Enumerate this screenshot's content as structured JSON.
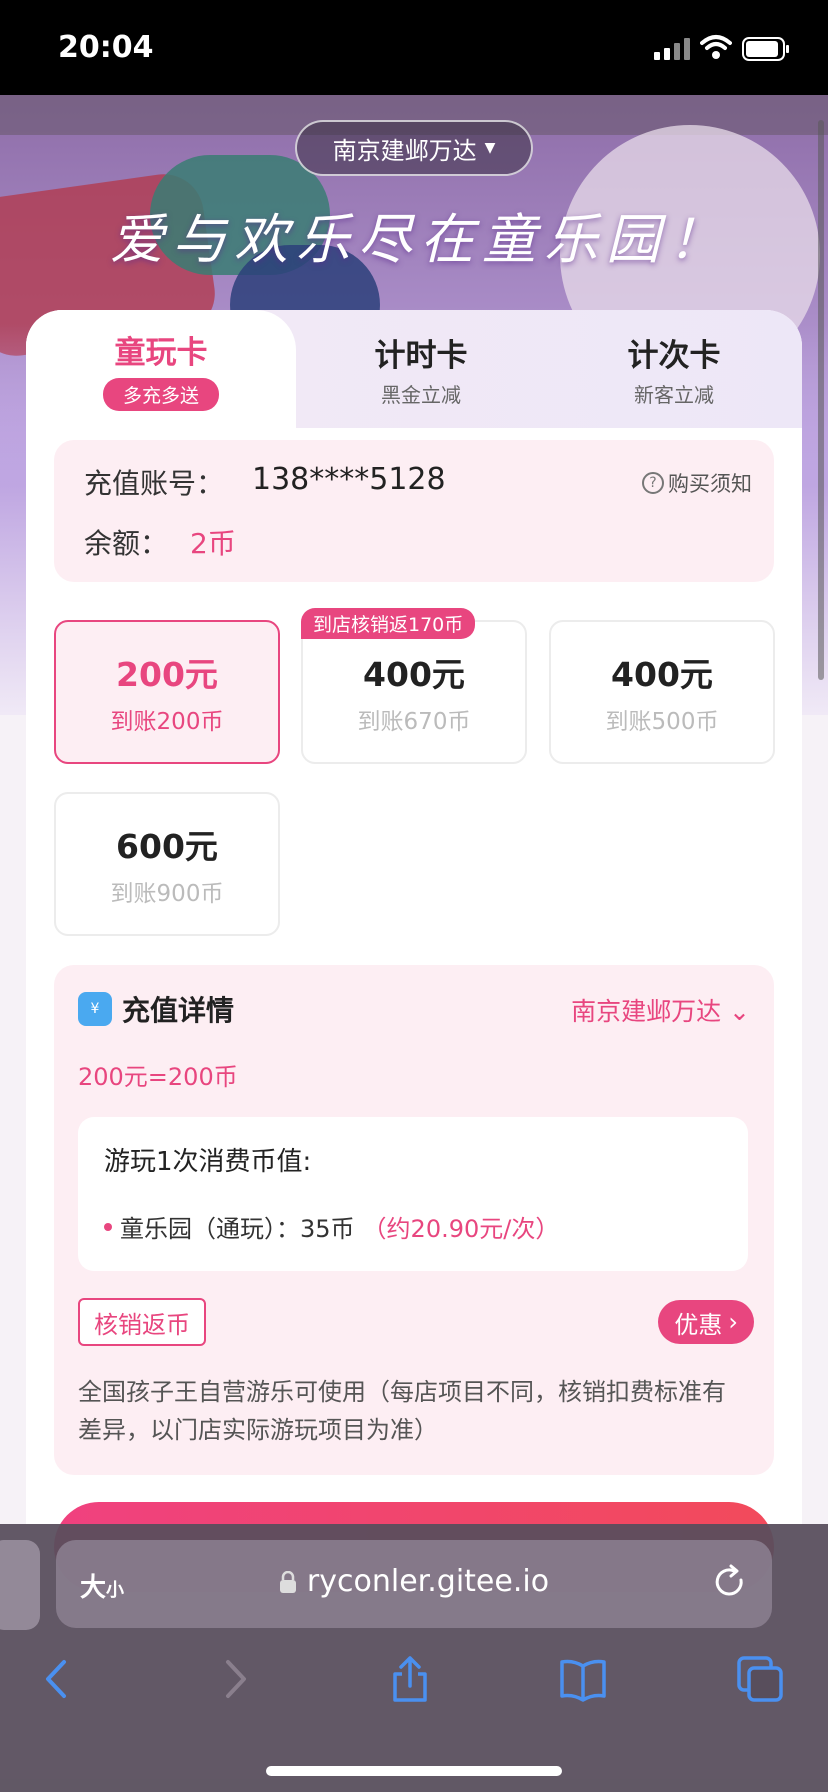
{
  "status_bar": {
    "time": "20:04"
  },
  "header": {
    "store": "南京建邺万达",
    "slogan": "爱与欢乐尽在童乐园！"
  },
  "tabs": [
    {
      "title": "童玩卡",
      "badge": "多充多送"
    },
    {
      "title": "计时卡",
      "sub": "黑金立减"
    },
    {
      "title": "计次卡",
      "sub": "新客立减"
    }
  ],
  "account": {
    "label": "充值账号：",
    "phone": "138****5128",
    "notice": "购买须知",
    "balance_label": "余额：",
    "balance": "2币"
  },
  "packages": [
    {
      "price": "200元",
      "coins": "到账200币",
      "selected": true
    },
    {
      "price": "400元",
      "coins": "到账670币",
      "tag": "到店核销返170币"
    },
    {
      "price": "400元",
      "coins": "到账500币"
    },
    {
      "price": "600元",
      "coins": "到账900币"
    }
  ],
  "detail": {
    "title": "充值详情",
    "store": "南京建邺万达",
    "rate": "200元=200币",
    "consume_title": "游玩1次消费币值:",
    "item": "童乐园（通玩）：35币",
    "item_approx": "（约20.90元/次）",
    "redeem_button": "核销返币",
    "offer_button": "优惠",
    "description": "全国孩子王自营游乐可使用（每店项目不同，核销扣费标准有差异，以门店实际游玩项目为准）"
  },
  "browser": {
    "text_size": "大",
    "text_size_small": "小",
    "url": "ryconler.gitee.io"
  },
  "colors": {
    "accent": "#e8467f",
    "accent_bg": "#fdeef3"
  }
}
